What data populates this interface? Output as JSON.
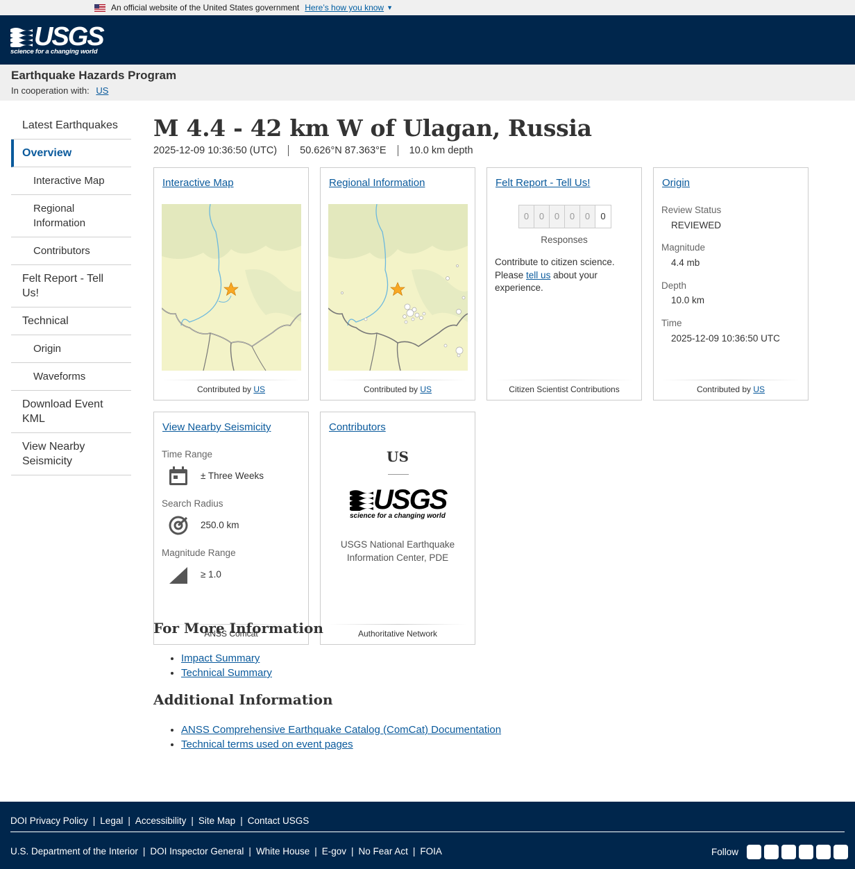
{
  "gov_banner": {
    "text": "An official website of the United States government",
    "link": "Here’s how you know"
  },
  "header": {
    "logo_text": "USGS",
    "logo_tagline": "science for a changing world"
  },
  "program": {
    "title": "Earthquake Hazards Program",
    "coop_label": "In cooperation with:",
    "coop_link": "US"
  },
  "sidenav": {
    "items": [
      {
        "label": "Latest Earthquakes"
      },
      {
        "label": "Overview"
      },
      {
        "label": "Interactive Map"
      },
      {
        "label": "Regional Information"
      },
      {
        "label": "Contributors"
      },
      {
        "label": "Felt Report - Tell Us!"
      },
      {
        "label": "Technical"
      },
      {
        "label": "Origin"
      },
      {
        "label": "Waveforms"
      },
      {
        "label": "Download Event KML"
      },
      {
        "label": "View Nearby Seismicity"
      }
    ]
  },
  "event": {
    "title": "M 4.4 - 42 km W of Ulagan, Russia",
    "time": "2025-12-09 10:36:50 (UTC)",
    "location": "50.626°N 87.363°E",
    "depth": "10.0 km depth"
  },
  "cards": {
    "interactive_map": {
      "title": "Interactive Map",
      "foot_prefix": "Contributed by",
      "foot_link": "US"
    },
    "regional": {
      "title": "Regional Information",
      "foot_prefix": "Contributed by",
      "foot_link": "US"
    },
    "felt": {
      "title": "Felt Report - Tell Us!",
      "digits": [
        "0",
        "0",
        "0",
        "0",
        "0",
        "0"
      ],
      "responses": "Responses",
      "text_1": "Contribute to citizen science. Please",
      "link": "tell us",
      "text_2": "about your experience.",
      "foot": "Citizen Scientist Contributions"
    },
    "origin": {
      "title": "Origin",
      "review_label": "Review Status",
      "review_value": "REVIEWED",
      "magnitude_label": "Magnitude",
      "magnitude_value": "4.4 mb",
      "depth_label": "Depth",
      "depth_value": "10.0 km",
      "time_label": "Time",
      "time_value": "2025-12-09 10:36:50 UTC",
      "foot_prefix": "Contributed by",
      "foot_link": "US"
    },
    "nearby": {
      "title": "View Nearby Seismicity",
      "time_label": "Time Range",
      "time_value": "± Three Weeks",
      "radius_label": "Search Radius",
      "radius_value": "250.0 km",
      "mag_label": "Magnitude Range",
      "mag_value": "≥ 1.0",
      "foot": "ANSS Comcat"
    },
    "contributors": {
      "title": "Contributors",
      "code": "US",
      "name": "USGS National Earthquake Information Center, PDE",
      "foot": "Authoritative Network"
    }
  },
  "more_info": {
    "heading": "For More Information",
    "links": [
      "Impact Summary",
      "Technical Summary"
    ]
  },
  "additional": {
    "heading": "Additional Information",
    "links": [
      "ANSS Comprehensive Earthquake Catalog (ComCat) Documentation",
      "Technical terms used on event pages"
    ]
  },
  "footer": {
    "row1": [
      "DOI Privacy Policy",
      "Legal",
      "Accessibility",
      "Site Map",
      "Contact USGS"
    ],
    "row2": [
      "U.S. Department of the Interior",
      "DOI Inspector General",
      "White House",
      "E-gov",
      "No Fear Act",
      "FOIA"
    ],
    "follow": "Follow",
    "social_icons": [
      "twitter-icon",
      "facebook-icon",
      "github-icon",
      "flickr-icon",
      "youtube-icon",
      "instagram-icon"
    ]
  }
}
